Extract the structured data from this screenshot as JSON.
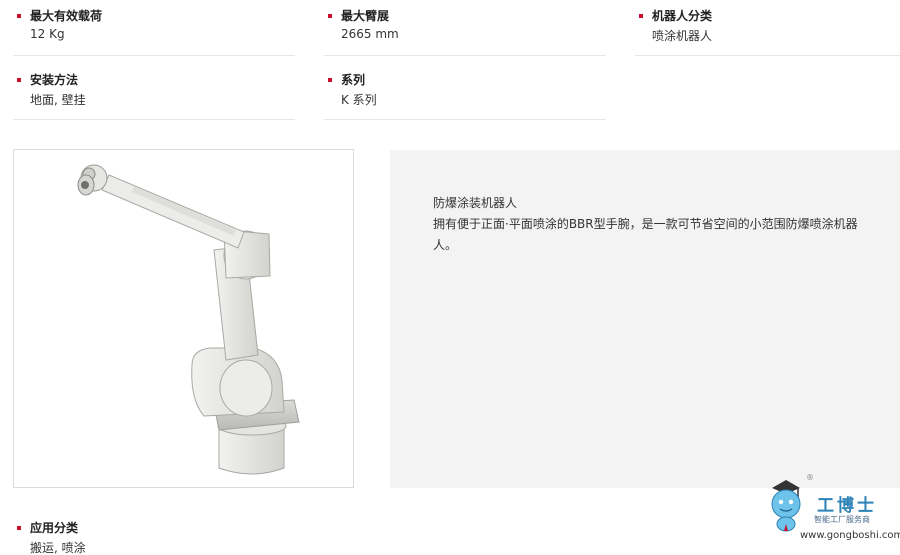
{
  "specs": {
    "max_payload": {
      "label": "最大有效载荷",
      "value": "12 Kg"
    },
    "max_reach": {
      "label": "最大臂展",
      "value": "2665 mm"
    },
    "category": {
      "label": "机器人分类",
      "value": "喷涂机器人"
    },
    "mounting": {
      "label": "安装方法",
      "value": "地面, 壁挂"
    },
    "series": {
      "label": "系列",
      "value": "K 系列"
    }
  },
  "application": {
    "label": "应用分类",
    "value": "搬运, 喷涂"
  },
  "description": {
    "title": "防爆涂装机器人",
    "text": "拥有便于正面·平面喷涂的BBR型手腕，是一款可节省空间的小范围防爆喷涂机器人。"
  },
  "watermark": {
    "brand": "工博士",
    "tagline": "智能工厂服务商",
    "url": "www.gongboshi.com",
    "registered": "®"
  },
  "colors": {
    "accent": "#c8102e",
    "divider": "#e6e6e6",
    "panel_bg": "#f3f3f3",
    "brand_blue": "#2d82b7"
  },
  "icons": [
    "bullet-square",
    "robot-arm-image",
    "mascot-logo"
  ]
}
